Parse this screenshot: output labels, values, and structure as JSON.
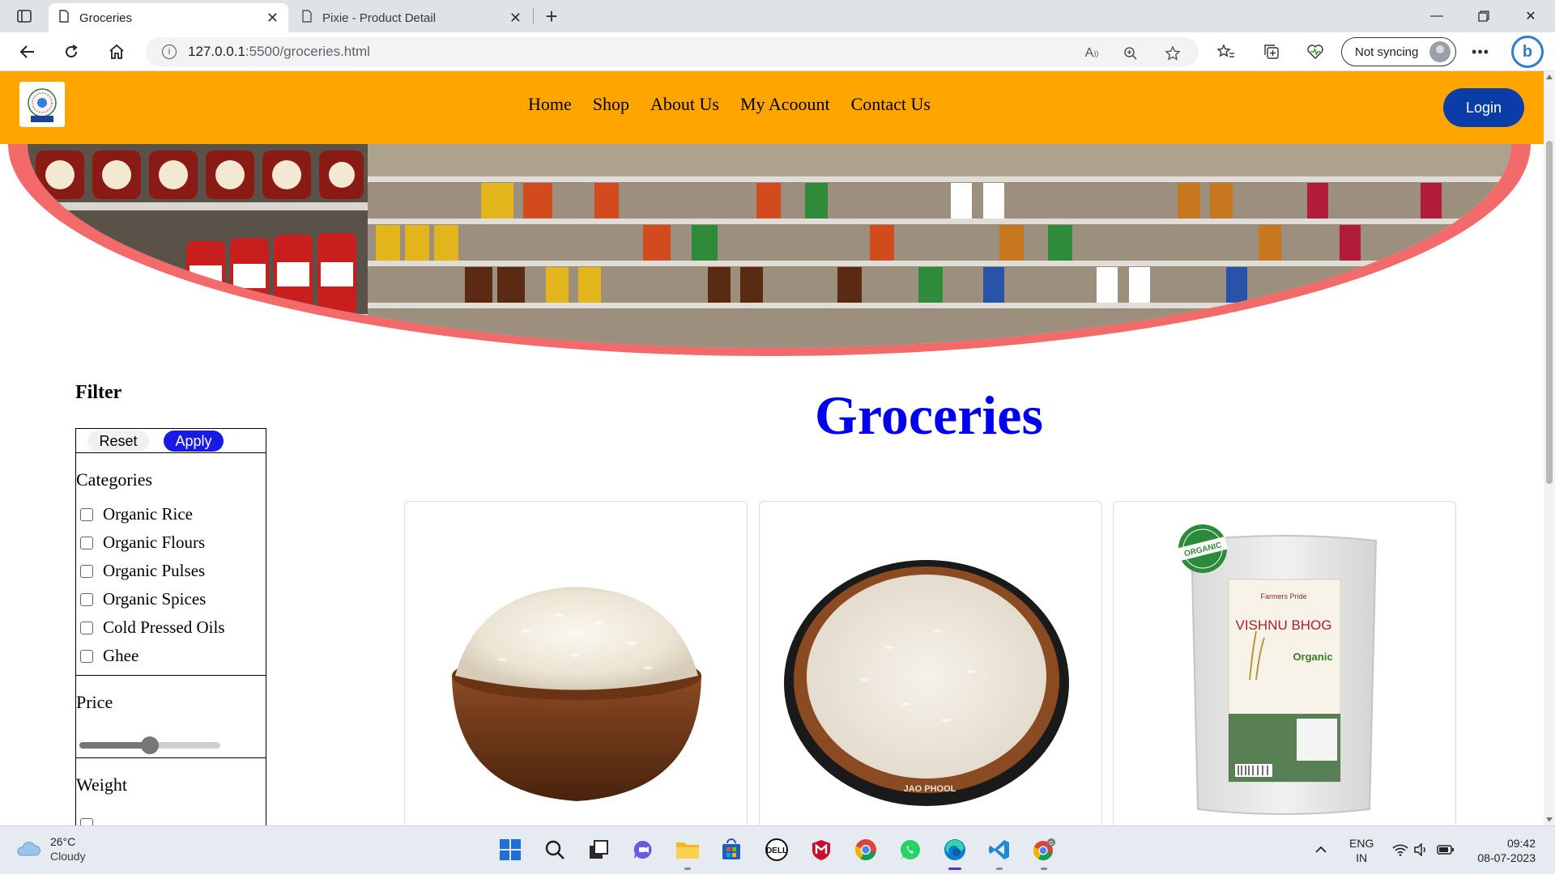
{
  "browser": {
    "tabs": [
      {
        "title": "Groceries",
        "active": true
      },
      {
        "title": "Pixie - Product Detail",
        "active": false
      }
    ],
    "url_host": "127.0.0.1",
    "url_path": ":5500/groceries.html",
    "sync_label": "Not syncing"
  },
  "site": {
    "logo_text": "CSVTU",
    "nav": [
      "Home",
      "Shop",
      "About Us",
      "My Acoount",
      "Contact Us"
    ],
    "login_label": "Login",
    "accent_color": "#ffa500",
    "banner_border_color": "#f26a6a"
  },
  "filter": {
    "heading": "Filter",
    "reset_label": "Reset",
    "apply_label": "Apply",
    "categories_title": "Categories",
    "categories": [
      "Organic Rice",
      "Organic Flours",
      "Organic Pulses",
      "Organic Spices",
      "Cold Pressed Oils",
      "Ghee"
    ],
    "price_title": "Price",
    "price_slider_value_fraction": 0.5,
    "weight_title": "Weight"
  },
  "products": {
    "title": "Groceries",
    "title_color": "#0000ee",
    "items": [
      {
        "image": "rice-in-wooden-bowl"
      },
      {
        "image": "rice-in-dark-wooden-plate",
        "plate_text": "JAO PHOOL"
      },
      {
        "image": "organic-rice-package",
        "badge_text": "ORGANIC",
        "brand": "Farmers Pride",
        "product_name": "VISHNU BHOG",
        "tag": "Organic"
      }
    ]
  },
  "taskbar": {
    "temperature": "26°C",
    "weather": "Cloudy",
    "lang_top": "ENG",
    "lang_bottom": "IN",
    "time": "09:42",
    "date": "08-07-2023"
  }
}
